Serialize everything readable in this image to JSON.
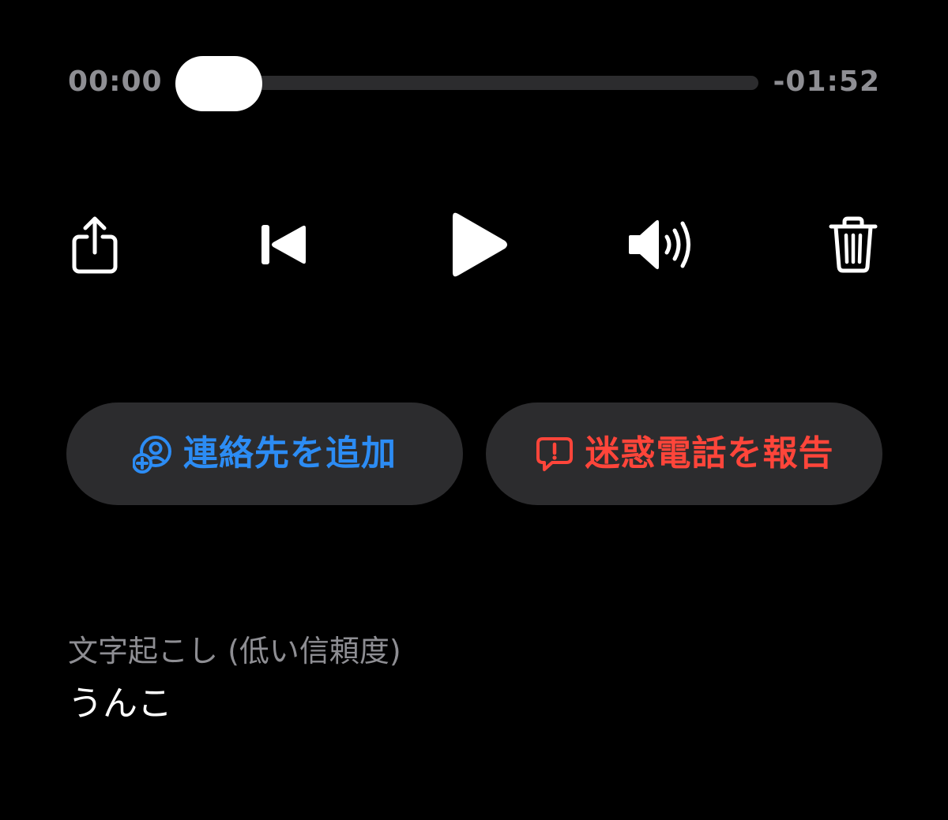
{
  "player": {
    "elapsed": "00:00",
    "remaining": "-01:52",
    "progress": 0.0
  },
  "controls": {
    "share_icon": "share-icon",
    "back_icon": "skip-back-icon",
    "play_icon": "play-icon",
    "volume_icon": "speaker-volume-icon",
    "trash_icon": "trash-icon"
  },
  "actions": {
    "add_contact": {
      "label": "連絡先を追加",
      "icon": "add-contact-icon",
      "color": "#2c8cf4"
    },
    "report_spam": {
      "label": "迷惑電話を報告",
      "icon": "report-bubble-icon",
      "color": "#ff453a"
    }
  },
  "transcript": {
    "heading": "文字起こし (低い信頼度)",
    "text": "うんこ"
  },
  "colors": {
    "background": "#000000",
    "pill_background": "#2c2c2e",
    "secondary_text": "#8e8e93",
    "track": "#2c2c2e"
  }
}
